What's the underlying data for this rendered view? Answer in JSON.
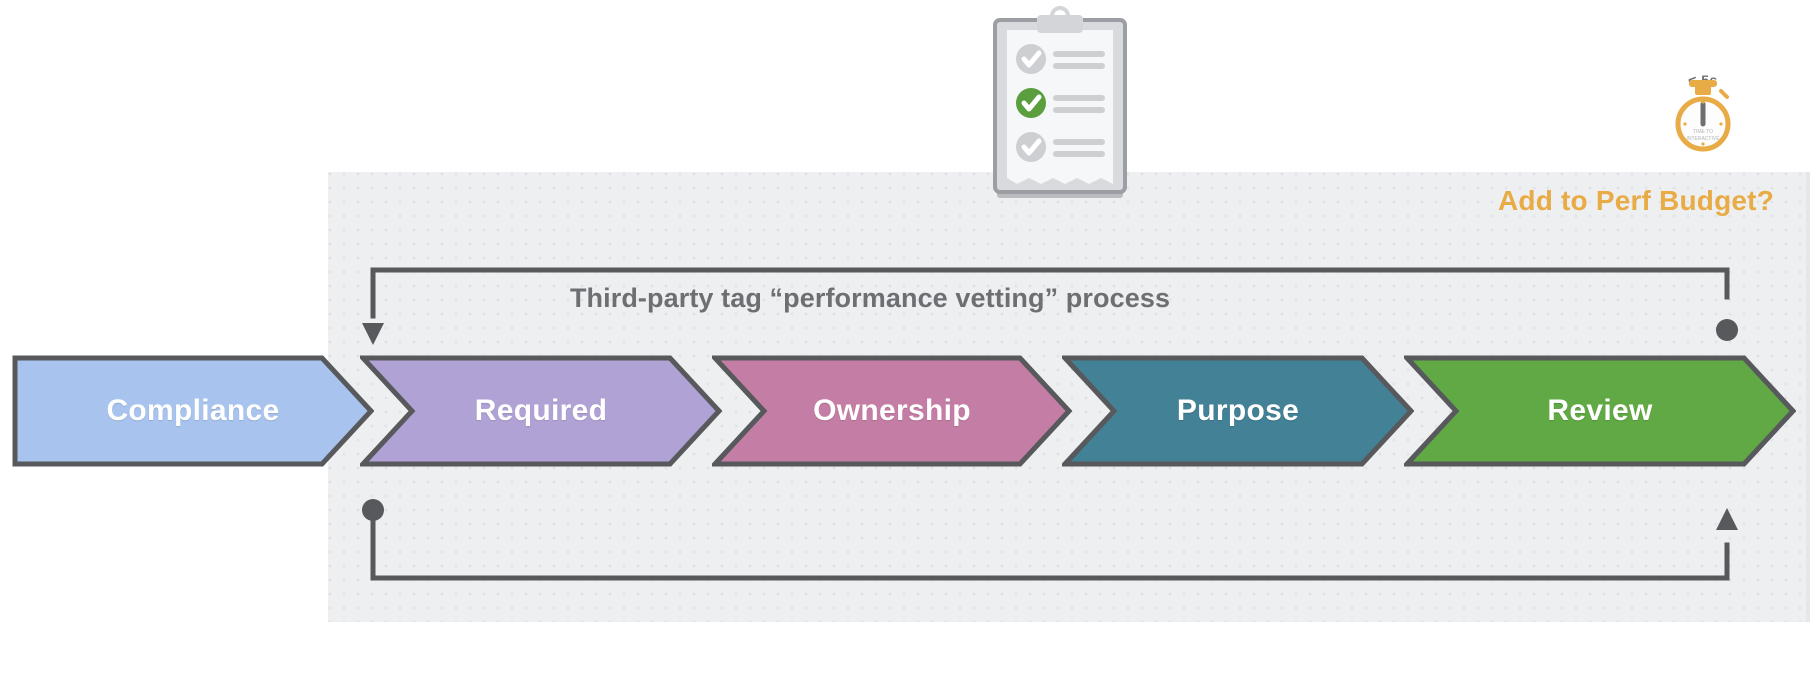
{
  "panel": {
    "perf_budget_label": "Add to Perf Budget?",
    "process_title": "Third-party tag “performance vetting” process",
    "background_color": "#eeeff1",
    "accent_color": "#e8ab45",
    "title_color": "#6d6f73"
  },
  "process": {
    "steps": [
      {
        "label": "Compliance",
        "color": "#a8c4ee",
        "border": "#57595c"
      },
      {
        "label": "Required",
        "color": "#b1a2d6",
        "border": "#57595c"
      },
      {
        "label": "Ownership",
        "color": "#c47da4",
        "border": "#57595c"
      },
      {
        "label": "Purpose",
        "color": "#438196",
        "border": "#57595c"
      },
      {
        "label": "Review",
        "color": "#61a945",
        "border": "#57595c"
      }
    ],
    "connector_color": "#57595c",
    "loop_top_note": "return path from Review back to Required",
    "loop_bottom_note": "return path from Required back to Review"
  },
  "icons": {
    "clipboard": {
      "name": "clipboard-checklist-icon",
      "checks": [
        "unchecked",
        "checked",
        "unchecked"
      ],
      "check_color": "#5a9e3e",
      "muted_color": "#c9cacc"
    },
    "stopwatch": {
      "name": "stopwatch-icon",
      "caption": "< 5s",
      "dial_label_line1": "TIME TO",
      "dial_label_line2": "INTERACTIVE",
      "color": "#e8ab45"
    }
  }
}
